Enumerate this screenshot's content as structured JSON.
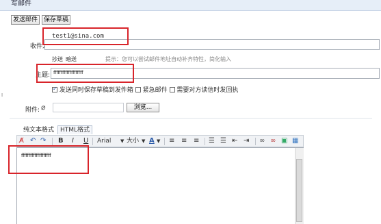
{
  "header": {
    "title": "写邮件"
  },
  "toolbar_top": {
    "send_label": "发送邮件",
    "draft_label": "保存草稿"
  },
  "recipient": {
    "label": "收件人:",
    "value": "test1@sina.com"
  },
  "cc_bcc": {
    "cc": "抄送",
    "bcc": "暗送",
    "hint": "提示：您可以尝试邮件地址自动补齐特性，简化输入"
  },
  "subject": {
    "label": "主题:",
    "value": "ffffffffffffffffffff"
  },
  "options": {
    "save_copy": "发送同时保存草稿到发件箱",
    "urgent": "紧急邮件",
    "read_receipt": "需要对方读信时发回执"
  },
  "attachment": {
    "label": "附件:",
    "browse": "浏览..."
  },
  "editor_tabs": {
    "plain": "纯文本格式",
    "html": "HTML格式"
  },
  "editor_toolbar": {
    "bold": "B",
    "italic": "I",
    "underline": "U",
    "font": "Arial",
    "size": "大小",
    "color_letter": "A"
  },
  "editor": {
    "body": "ffffffffffffffffffff"
  },
  "colors": {
    "highlight": "#d8242a",
    "header_bg": "#e6eef8",
    "accent_blue": "#2b5aa8"
  }
}
